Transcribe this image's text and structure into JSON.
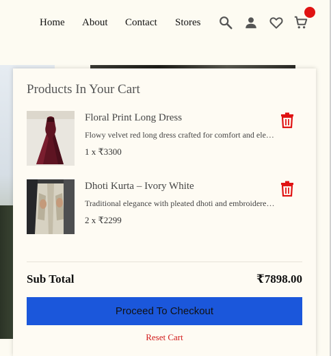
{
  "nav": {
    "links": [
      "Home",
      "About",
      "Contact",
      "Stores"
    ],
    "icons": [
      "search-icon",
      "user-icon",
      "heart-icon",
      "cart-icon"
    ],
    "cart_badge_color": "#e01313"
  },
  "cart": {
    "title": "Products In Your Cart",
    "items": [
      {
        "name": "Floral Print Long Dress",
        "description": "Flowy velvet red long dress crafted for comfort and elegance",
        "qty": "1 x ₹3300"
      },
      {
        "name": "Dhoti Kurta – Ivory White",
        "description": "Traditional elegance with pleated dhoti and embroidered kurta",
        "qty": "2 x ₹2299"
      }
    ],
    "subtotal_label": "Sub Total",
    "subtotal_value": "₹7898.00",
    "checkout_label": "Proceed To Checkout",
    "reset_label": "Reset Cart"
  },
  "colors": {
    "accent": "#1b57db",
    "danger": "#d11a1a",
    "background": "#fdfbf2"
  }
}
